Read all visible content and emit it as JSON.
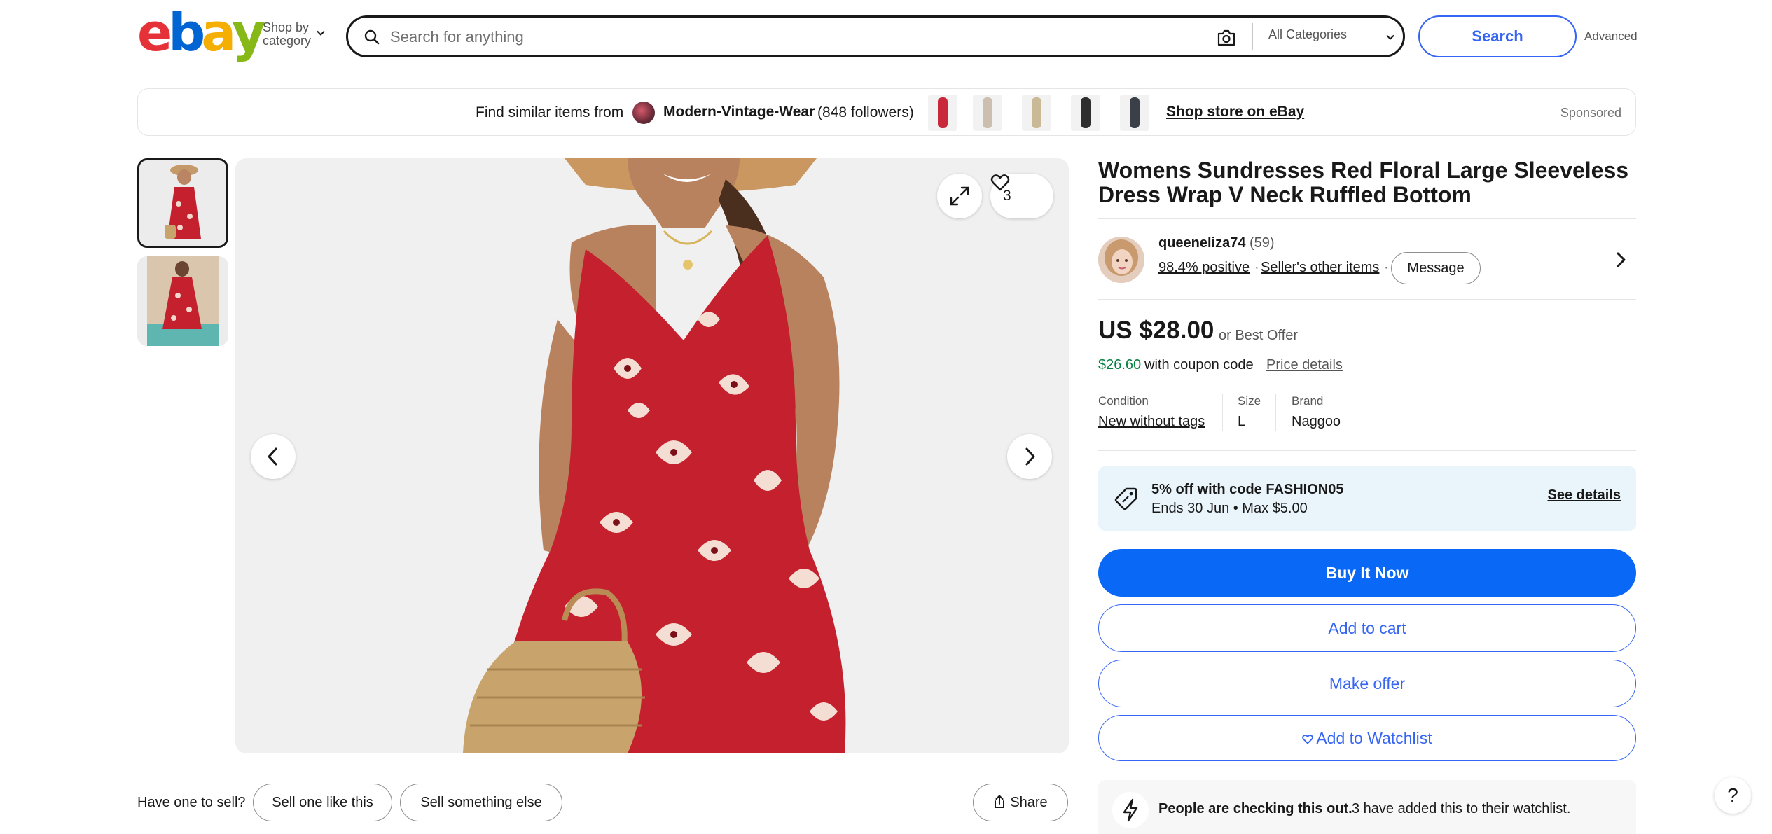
{
  "header": {
    "logo": {
      "letters": [
        "e",
        "b",
        "a",
        "y"
      ]
    },
    "shop_by_line1": "Shop by",
    "shop_by_line2": "category",
    "search_placeholder": "Search for anything",
    "category": "All Categories",
    "search_button": "Search",
    "advanced": "Advanced"
  },
  "store_banner": {
    "find_similar": "Find similar items from",
    "store_name": "Modern-Vintage-Wear",
    "followers": "(848 followers)",
    "shop_link": "Shop store on eBay",
    "sponsored": "Sponsored",
    "thumb_colors": [
      "#c8283a",
      "#cdbfaf",
      "#c9b996",
      "#2e2e2e",
      "#3a3f48"
    ]
  },
  "gallery": {
    "watch_count": "3",
    "selected_thumb": 1,
    "thumb_count": 2,
    "dress_color": "#c5202e"
  },
  "product": {
    "title": "Womens Sundresses Red Floral Large Sleeveless Dress Wrap V Neck Ruffled Bottom",
    "seller": {
      "name": "queeneliza74",
      "feedback_count": "(59)",
      "positive": "98.4% positive",
      "other_items": "Seller's other items",
      "message": "Message"
    },
    "price": "US $28.00",
    "best_offer": "or Best Offer",
    "coupon_price": "$26.60",
    "coupon_text": "with coupon code",
    "price_details": "Price details",
    "specs": [
      {
        "label": "Condition",
        "value": "New without tags"
      },
      {
        "label": "Size",
        "value": "L"
      },
      {
        "label": "Brand",
        "value": "Naggoo"
      }
    ],
    "promo": {
      "line1": "5% off with code FASHION05",
      "line2": "Ends 30 Jun • Max $5.00",
      "see_details": "See details"
    },
    "buttons": {
      "buy_now": "Buy It Now",
      "add_to_cart": "Add to cart",
      "make_offer": "Make offer",
      "watchlist": "Add to Watchlist"
    },
    "checking": {
      "strong": "People are checking this out.",
      "text": "3 have added this to their watchlist."
    }
  },
  "bottom": {
    "have_one": "Have one to sell?",
    "sell_like": "Sell one like this",
    "sell_else": "Sell something else",
    "share": "Share",
    "help": "?"
  },
  "colors": {
    "brand_blue": "#3665f3",
    "buy_blue": "#0968f6",
    "coupon_green": "#05823f",
    "promo_bg": "#eaf4fb"
  }
}
